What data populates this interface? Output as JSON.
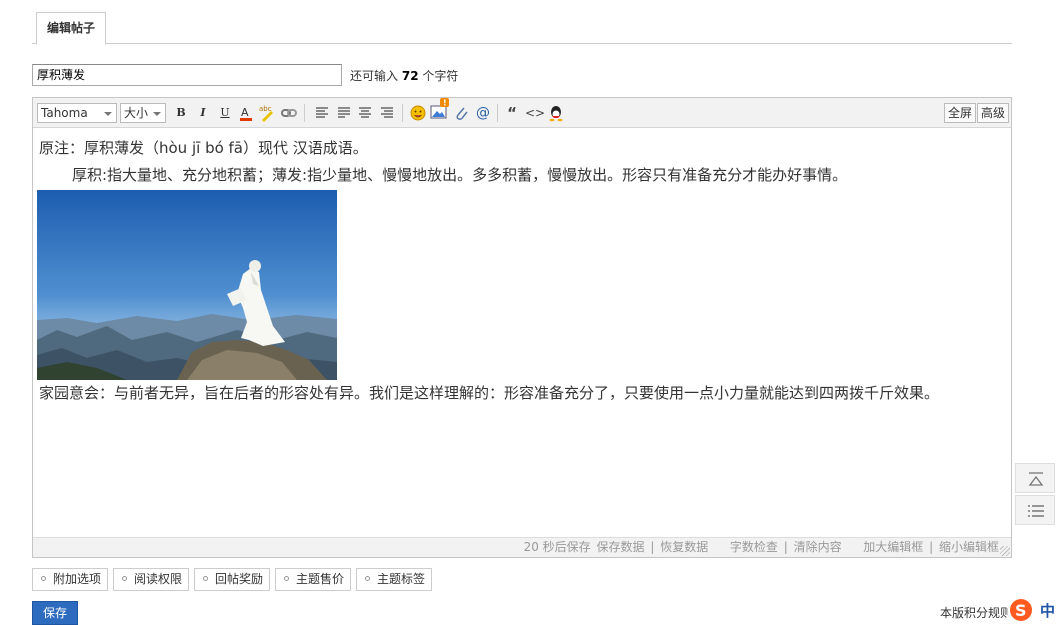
{
  "tab": {
    "label": "编辑帖子"
  },
  "subject": {
    "value": "厚积薄发"
  },
  "remain": {
    "prefix": "还可输入",
    "count": "72",
    "suffix": "个字符"
  },
  "toolbar": {
    "font_family": "Tahoma",
    "font_size": "大小",
    "bold": "B",
    "italic": "I",
    "underline": "U",
    "fullscreen": "全屏",
    "advanced": "高级",
    "icons": [
      "bold-icon",
      "italic-icon",
      "underline-icon",
      "font-color-icon",
      "background-color-icon",
      "link-icon",
      "align-left-icon",
      "align-center-icon",
      "align-justify-icon",
      "align-right-icon",
      "emoji-icon",
      "image-icon",
      "attachment-icon",
      "at-icon",
      "quote-icon",
      "code-icon",
      "qq-icon"
    ]
  },
  "content": {
    "line1": "原注：厚积薄发（hòu jī bó fā）现代 汉语成语。",
    "line2": "厚积:指大量地、充分地积蓄；薄发:指少量地、慢慢地放出。多多积蓄，慢慢放出。形容只有准备充分才能办好事情。",
    "line3": "家园意会：与前者无异，旨在后者的形容处有异。我们是这样理解的：形容准备充分了，只要使用一点小力量就能达到四两拨千斤效果。"
  },
  "statusbar": {
    "autosave": "20 秒后保存",
    "save_data": "保存数据",
    "restore_data": "恢复数据",
    "word_check": "字数检查",
    "clear_content": "清除内容",
    "enlarge": "加大编辑框",
    "shrink": "缩小编辑框"
  },
  "options": [
    "附加选项",
    "阅读权限",
    "回帖奖励",
    "主题售价",
    "主题标签"
  ],
  "save_label": "保存",
  "rules_label": "本版积分规则",
  "ime_label": "中"
}
